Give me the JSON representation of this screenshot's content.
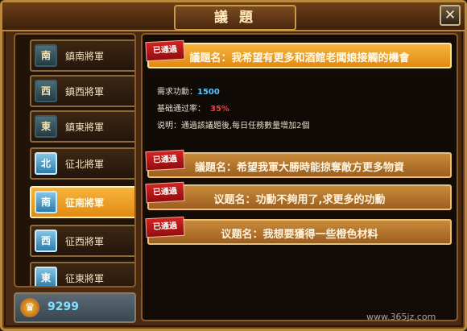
{
  "window": {
    "title": "議 題",
    "close": "✕"
  },
  "ranks": [
    {
      "label": "鎮南將軍",
      "glyph": "南",
      "style": "dark"
    },
    {
      "label": "鎮西將軍",
      "glyph": "西",
      "style": "dark"
    },
    {
      "label": "鎮東將軍",
      "glyph": "東",
      "style": "dark"
    },
    {
      "label": "征北將軍",
      "glyph": "北",
      "style": "blue"
    },
    {
      "label": "征南將軍",
      "glyph": "南",
      "style": "blue",
      "selected": true
    },
    {
      "label": "征西將軍",
      "glyph": "西",
      "style": "blue"
    },
    {
      "label": "征東將軍",
      "glyph": "東",
      "style": "blue"
    }
  ],
  "currency": {
    "icon": "crown-coin-icon",
    "value": "9299"
  },
  "topics": [
    {
      "badge": "已通過",
      "text": "議題名：我希望有更多和酒館老闆娘接觸的機會",
      "expanded": true
    },
    {
      "badge": "已通過",
      "text": "議題名：希望我軍大勝時能掠奪敵方更多物資"
    },
    {
      "badge": "已通過",
      "text": "议题名：功勳不夠用了,求更多的功勳"
    },
    {
      "badge": "已通過",
      "text": "议题名：我想要獲得一些橙色材料"
    }
  ],
  "details": {
    "merit_label": "需求功勳：",
    "merit_value": "1500",
    "rate_label": "基础通过率：",
    "rate_value": "35%",
    "desc_label": "说明：",
    "desc_value": "通過該議題後,每日任務數量增加2個"
  },
  "watermark": "www.365jz.com"
}
